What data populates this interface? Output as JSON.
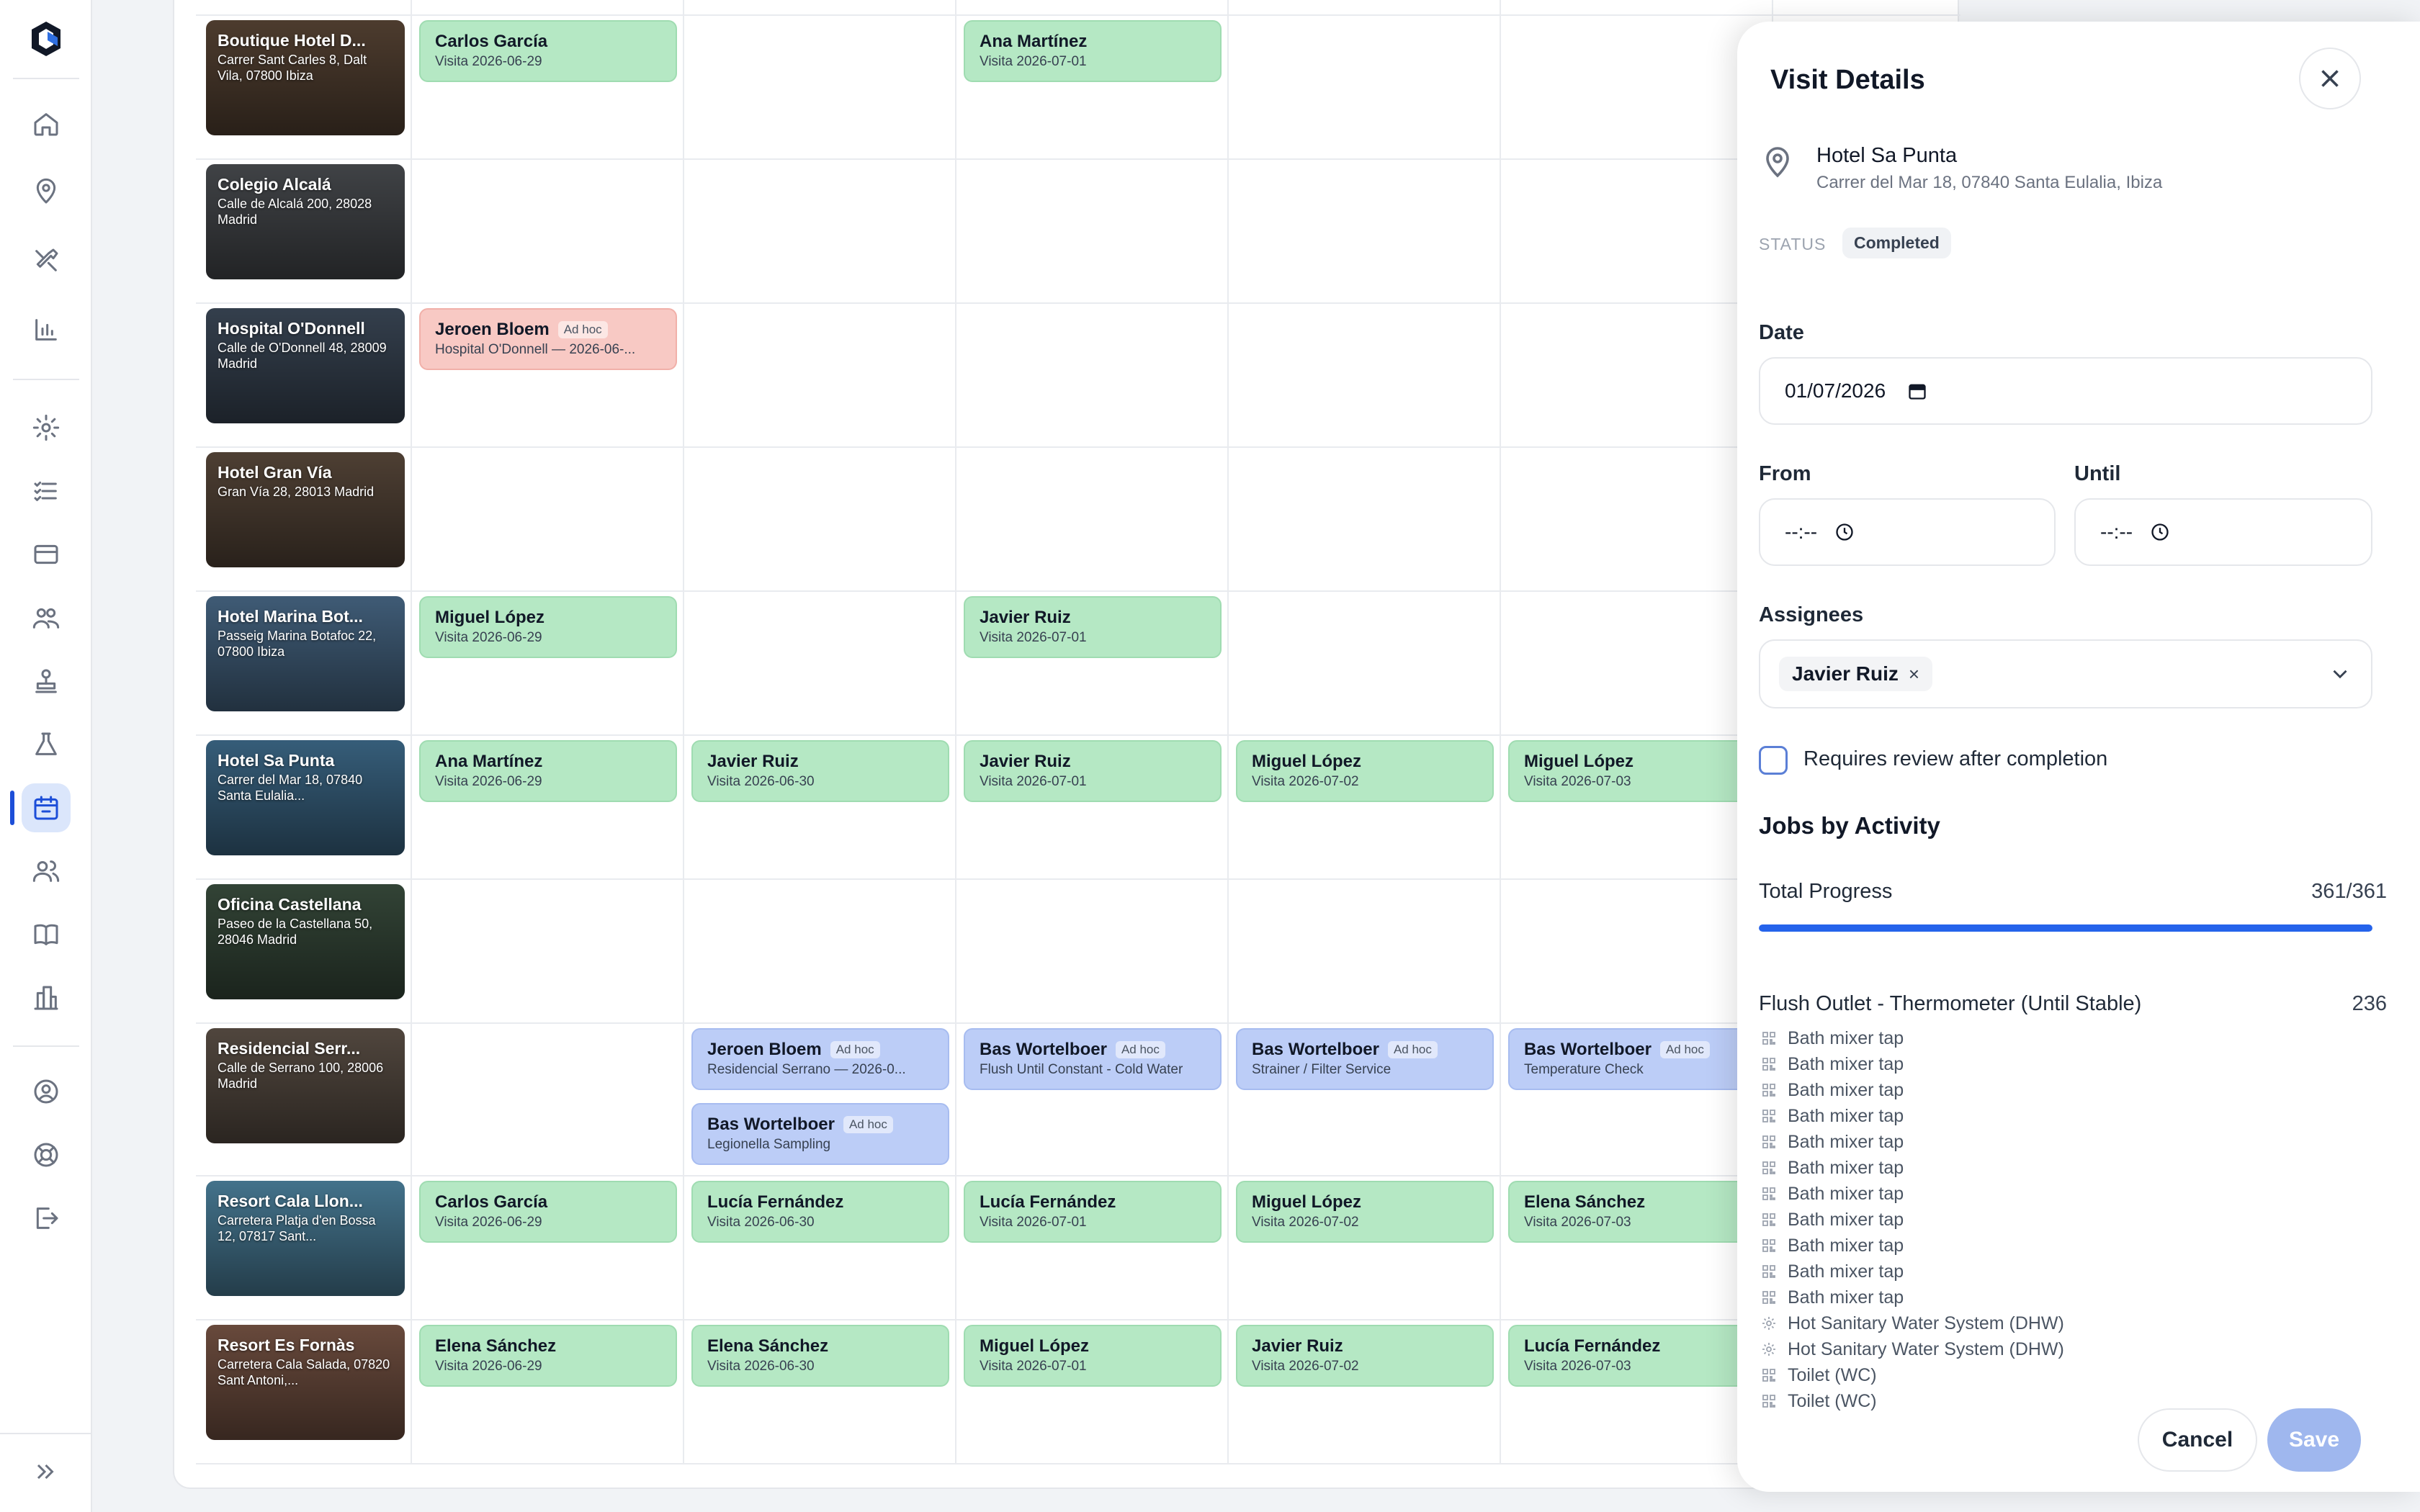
{
  "sidebar": {
    "logo": "app-logo",
    "icons": [
      "home-icon",
      "map-pin-icon",
      "tools-icon",
      "bar-chart-icon",
      "gear-icon",
      "checklist-icon",
      "card-icon",
      "team-icon",
      "stamp-icon",
      "flask-icon",
      "calendar-icon",
      "users-icon",
      "book-icon",
      "building-icon",
      "user-circle-icon",
      "help-icon",
      "logout-icon"
    ],
    "active": "calendar-icon",
    "expand_icon": "double-chevron-right-icon"
  },
  "schedule": {
    "rows": [
      {
        "name": "Boutique Hotel D...",
        "address": "Carrer Sant Carles 8, Dalt Vila, 07800 Ibiza",
        "photo": "#5a4636"
      },
      {
        "name": "Colegio Alcalá",
        "address": "Calle de Alcalá 200, 28028 Madrid",
        "photo": "#4b4e52"
      },
      {
        "name": "Hospital O'Donnell",
        "address": "Calle de O'Donnell 48, 28009 Madrid",
        "photo": "#3d4a5a"
      },
      {
        "name": "Hotel Gran Vía",
        "address": "Gran Vía 28, 28013 Madrid",
        "photo": "#5b4a3c"
      },
      {
        "name": "Hotel Marina Bot...",
        "address": "Passeig Marina Botafoc 22, 07800 Ibiza",
        "photo": "#4a6b8a"
      },
      {
        "name": "Hotel Sa Punta",
        "address": "Carrer del Mar 18, 07840 Santa Eulalia...",
        "photo": "#3f6d8e"
      },
      {
        "name": "Oficina Castellana",
        "address": "Paseo de la Castellana 50, 28046 Madrid",
        "photo": "#3b4f3f"
      },
      {
        "name": "Residencial Serr...",
        "address": "Calle de Serrano 100, 28006 Madrid",
        "photo": "#5e5248"
      },
      {
        "name": "Resort Cala Llon...",
        "address": "Carretera Platja d'en Bossa 12, 07817 Sant...",
        "photo": "#4f86a3"
      },
      {
        "name": "Resort Es Fornàs",
        "address": "Carretera Cala Salada, 07820 Sant Antoni,...",
        "photo": "#7a5646"
      }
    ],
    "visits": [
      {
        "row": 0,
        "col": 0,
        "name": "Carlos García",
        "sub": "Visita 2026-06-29",
        "kind": "normal",
        "tag": ""
      },
      {
        "row": 0,
        "col": 2,
        "name": "Ana Martínez",
        "sub": "Visita 2026-07-01",
        "kind": "normal",
        "tag": ""
      },
      {
        "row": 2,
        "col": 0,
        "name": "Jeroen Bloem",
        "sub": "Hospital O'Donnell — 2026-06-...",
        "kind": "adhoc-red",
        "tag": "Ad hoc"
      },
      {
        "row": 4,
        "col": 0,
        "name": "Miguel López",
        "sub": "Visita 2026-06-29",
        "kind": "normal",
        "tag": ""
      },
      {
        "row": 4,
        "col": 2,
        "name": "Javier Ruiz",
        "sub": "Visita 2026-07-01",
        "kind": "normal",
        "tag": ""
      },
      {
        "row": 5,
        "col": 0,
        "name": "Ana Martínez",
        "sub": "Visita 2026-06-29",
        "kind": "normal",
        "tag": ""
      },
      {
        "row": 5,
        "col": 1,
        "name": "Javier Ruiz",
        "sub": "Visita 2026-06-30",
        "kind": "normal",
        "tag": ""
      },
      {
        "row": 5,
        "col": 2,
        "name": "Javier Ruiz",
        "sub": "Visita 2026-07-01",
        "kind": "normal",
        "tag": ""
      },
      {
        "row": 5,
        "col": 3,
        "name": "Miguel López",
        "sub": "Visita 2026-07-02",
        "kind": "normal",
        "tag": ""
      },
      {
        "row": 5,
        "col": 4,
        "name": "Miguel López",
        "sub": "Visita 2026-07-03",
        "kind": "normal",
        "tag": ""
      },
      {
        "row": 7,
        "col": 1,
        "name": "Jeroen Bloem",
        "sub": "Residencial Serrano — 2026-0...",
        "kind": "adhoc-blue",
        "tag": "Ad hoc"
      },
      {
        "row": 7,
        "col": 1,
        "stack": 1,
        "name": "Bas Wortelboer",
        "sub": "Legionella Sampling",
        "kind": "adhoc-blue",
        "tag": "Ad hoc"
      },
      {
        "row": 7,
        "col": 2,
        "name": "Bas Wortelboer",
        "sub": "Flush Until Constant - Cold Water",
        "kind": "adhoc-blue",
        "tag": "Ad hoc"
      },
      {
        "row": 7,
        "col": 3,
        "name": "Bas Wortelboer",
        "sub": "Strainer / Filter Service",
        "kind": "adhoc-blue",
        "tag": "Ad hoc"
      },
      {
        "row": 7,
        "col": 4,
        "name": "Bas Wortelboer",
        "sub": "Temperature Check",
        "kind": "adhoc-blue",
        "tag": "Ad hoc"
      },
      {
        "row": 8,
        "col": 0,
        "name": "Carlos García",
        "sub": "Visita 2026-06-29",
        "kind": "normal",
        "tag": ""
      },
      {
        "row": 8,
        "col": 1,
        "name": "Lucía Fernández",
        "sub": "Visita 2026-06-30",
        "kind": "normal",
        "tag": ""
      },
      {
        "row": 8,
        "col": 2,
        "name": "Lucía Fernández",
        "sub": "Visita 2026-07-01",
        "kind": "normal",
        "tag": ""
      },
      {
        "row": 8,
        "col": 3,
        "name": "Miguel López",
        "sub": "Visita 2026-07-02",
        "kind": "normal",
        "tag": ""
      },
      {
        "row": 8,
        "col": 4,
        "name": "Elena Sánchez",
        "sub": "Visita 2026-07-03",
        "kind": "normal",
        "tag": ""
      },
      {
        "row": 9,
        "col": 0,
        "name": "Elena Sánchez",
        "sub": "Visita 2026-06-29",
        "kind": "normal",
        "tag": ""
      },
      {
        "row": 9,
        "col": 1,
        "name": "Elena Sánchez",
        "sub": "Visita 2026-06-30",
        "kind": "normal",
        "tag": ""
      },
      {
        "row": 9,
        "col": 2,
        "name": "Miguel López",
        "sub": "Visita 2026-07-01",
        "kind": "normal",
        "tag": ""
      },
      {
        "row": 9,
        "col": 3,
        "name": "Javier Ruiz",
        "sub": "Visita 2026-07-02",
        "kind": "normal",
        "tag": ""
      },
      {
        "row": 9,
        "col": 4,
        "name": "Lucía Fernández",
        "sub": "Visita 2026-07-03",
        "kind": "normal",
        "tag": ""
      }
    ]
  },
  "panel": {
    "title": "Visit Details",
    "location_name": "Hotel Sa Punta",
    "location_address": "Carrer del Mar 18, 07840 Santa Eulalia, Ibiza",
    "status_label": "STATUS",
    "status_value": "Completed",
    "date_label": "Date",
    "date_value": "01/07/2026",
    "from_label": "From",
    "from_value": "--:--",
    "until_label": "Until",
    "until_value": "--:--",
    "assignees_label": "Assignees",
    "assignee_chip": "Javier Ruiz",
    "assignee_remove": "×",
    "review_label": "Requires review after completion",
    "review_checked": false,
    "jobs_title": "Jobs by Activity",
    "total_progress_label": "Total Progress",
    "total_progress_value": "361/361",
    "progress_fraction": 1.0,
    "activity_name": "Flush Outlet - Thermometer (Until Stable)",
    "activity_count": "236",
    "jobs": [
      {
        "label": "Bath mixer tap",
        "icon": "qr-icon"
      },
      {
        "label": "Bath mixer tap",
        "icon": "qr-icon"
      },
      {
        "label": "Bath mixer tap",
        "icon": "qr-icon"
      },
      {
        "label": "Bath mixer tap",
        "icon": "qr-icon"
      },
      {
        "label": "Bath mixer tap",
        "icon": "qr-icon"
      },
      {
        "label": "Bath mixer tap",
        "icon": "qr-icon"
      },
      {
        "label": "Bath mixer tap",
        "icon": "qr-icon"
      },
      {
        "label": "Bath mixer tap",
        "icon": "qr-icon"
      },
      {
        "label": "Bath mixer tap",
        "icon": "qr-icon"
      },
      {
        "label": "Bath mixer tap",
        "icon": "qr-icon"
      },
      {
        "label": "Bath mixer tap",
        "icon": "qr-icon"
      },
      {
        "label": "Hot Sanitary Water System (DHW)",
        "icon": "gear-icon"
      },
      {
        "label": "Hot Sanitary Water System (DHW)",
        "icon": "gear-icon"
      },
      {
        "label": "Toilet (WC)",
        "icon": "qr-icon"
      },
      {
        "label": "Toilet (WC)",
        "icon": "qr-icon"
      }
    ],
    "cancel_label": "Cancel",
    "save_label": "Save",
    "colors": {
      "accent": "#2563eb",
      "save_disabled": "#9fb7ee"
    }
  }
}
